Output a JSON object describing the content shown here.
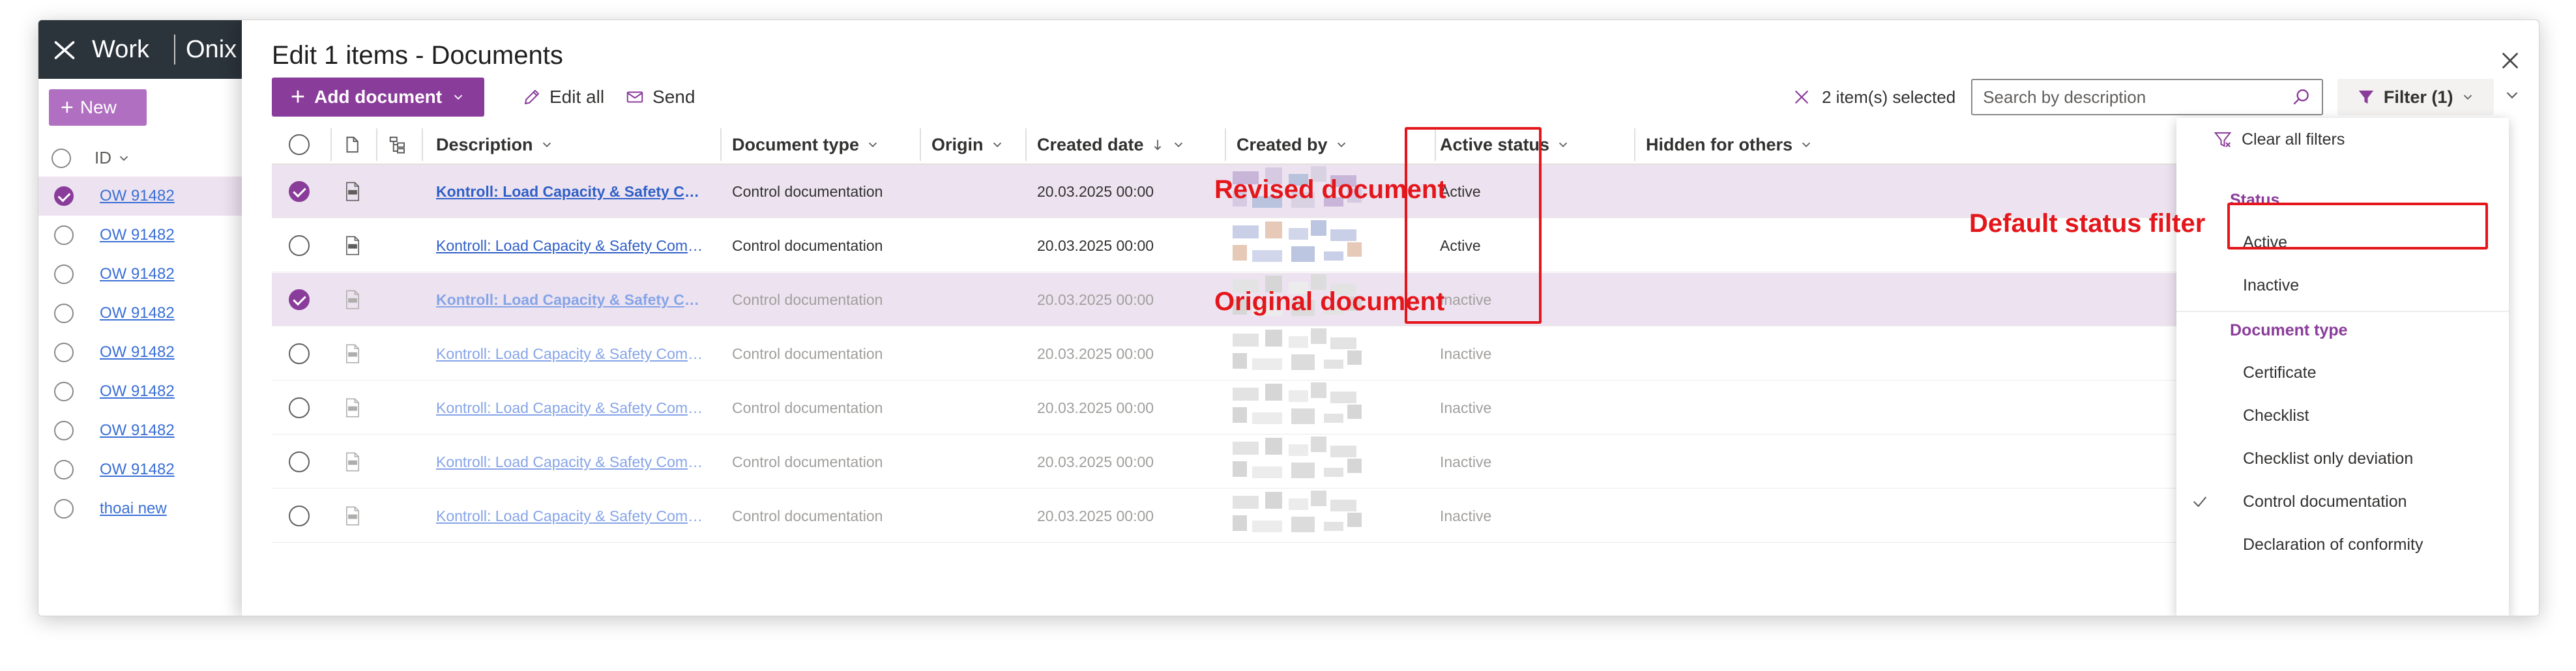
{
  "app": {
    "name": "Work",
    "subtitle": "Onix T",
    "new_label": "New",
    "id_column": "ID"
  },
  "background_rows": [
    {
      "id": "OW 91482",
      "selected": true
    },
    {
      "id": "OW 91482",
      "selected": false
    },
    {
      "id": "OW 91482",
      "selected": false
    },
    {
      "id": "OW 91482",
      "selected": false
    },
    {
      "id": "OW 91482",
      "selected": false
    },
    {
      "id": "OW 91482",
      "selected": false
    },
    {
      "id": "OW 91482",
      "selected": false
    },
    {
      "id": "OW 91482",
      "selected": false
    },
    {
      "id": "thoai new",
      "selected": false
    }
  ],
  "panel": {
    "title": "Edit 1 items - Documents"
  },
  "toolbar": {
    "add_document": "Add document",
    "edit_all": "Edit all",
    "send": "Send",
    "selected_count": "2 item(s) selected",
    "search_placeholder": "Search by description",
    "filter_label": "Filter (1)"
  },
  "columns": {
    "description": "Description",
    "document_type": "Document type",
    "origin": "Origin",
    "created_date": "Created date",
    "created_by": "Created by",
    "active_status": "Active status",
    "hidden_for_others": "Hidden for others"
  },
  "rows": [
    {
      "description": "Kontroll: Load Capacity & Safety Com...",
      "document_type": "Control documentation",
      "created_date": "20.03.2025 00:00",
      "status": "Active",
      "selected": true,
      "inactive": false
    },
    {
      "description": "Kontroll: Load Capacity & Safety Complia...",
      "document_type": "Control documentation",
      "created_date": "20.03.2025 00:00",
      "status": "Active",
      "selected": false,
      "inactive": false
    },
    {
      "description": "Kontroll: Load Capacity & Safety Com...",
      "document_type": "Control documentation",
      "created_date": "20.03.2025 00:00",
      "status": "Inactive",
      "selected": true,
      "inactive": true
    },
    {
      "description": "Kontroll: Load Capacity & Safety Complia...",
      "document_type": "Control documentation",
      "created_date": "20.03.2025 00:00",
      "status": "Inactive",
      "selected": false,
      "inactive": true
    },
    {
      "description": "Kontroll: Load Capacity & Safety Complia...",
      "document_type": "Control documentation",
      "created_date": "20.03.2025 00:00",
      "status": "Inactive",
      "selected": false,
      "inactive": true
    },
    {
      "description": "Kontroll: Load Capacity & Safety Complia...",
      "document_type": "Control documentation",
      "created_date": "20.03.2025 00:00",
      "status": "Inactive",
      "selected": false,
      "inactive": true
    },
    {
      "description": "Kontroll: Load Capacity & Safety Complia...",
      "document_type": "Control documentation",
      "created_date": "20.03.2025 00:00",
      "status": "Inactive",
      "selected": false,
      "inactive": true
    }
  ],
  "filter_menu": {
    "clear_all": "Clear all filters",
    "status_header": "Status",
    "status_options": [
      {
        "label": "Active",
        "checked": false
      },
      {
        "label": "Inactive",
        "checked": false
      }
    ],
    "doctype_header": "Document type",
    "doctype_options": [
      {
        "label": "Certificate",
        "checked": false
      },
      {
        "label": "Checklist",
        "checked": false
      },
      {
        "label": "Checklist only deviation",
        "checked": false
      },
      {
        "label": "Control documentation",
        "checked": true
      },
      {
        "label": "Declaration of conformity",
        "checked": false
      }
    ]
  },
  "annotations": {
    "revised": "Revised document",
    "original": "Original document",
    "default_filter": "Default status filter"
  },
  "colors": {
    "accent": "#8a3c9a",
    "selected_row": "#ede3f0",
    "annotation": "#e4161b",
    "link": "#2f5fc7"
  }
}
